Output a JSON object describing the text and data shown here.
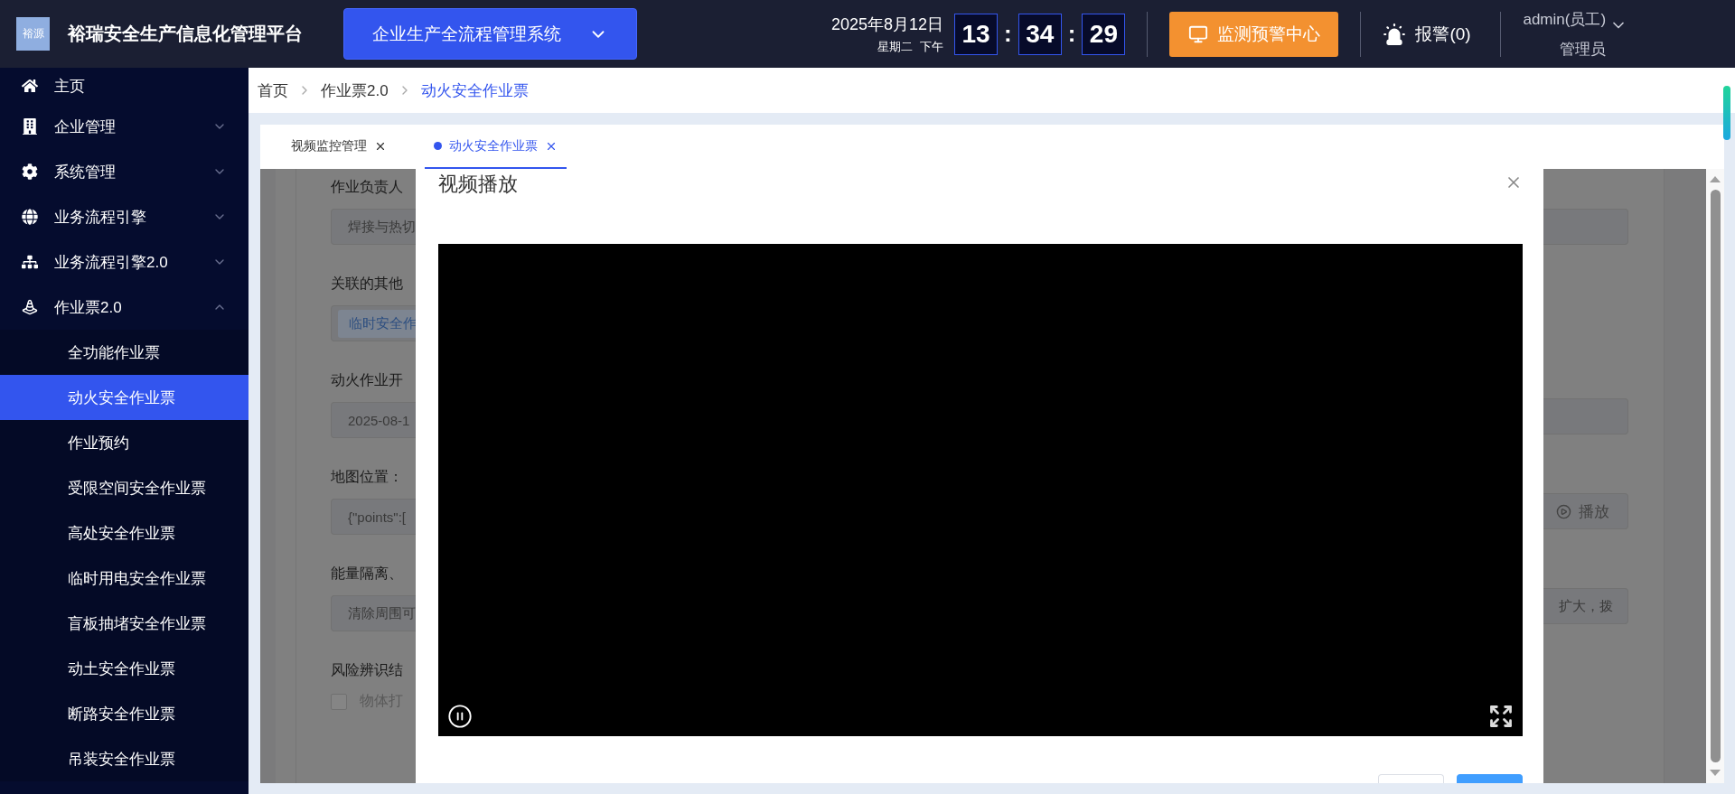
{
  "header": {
    "logo": "裕源",
    "title": "裕瑞安全生产信息化管理平台",
    "system_selector": "企业生产全流程管理系统",
    "date": "2025年8月12日",
    "weekday": "星期二",
    "period": "下午",
    "clock": [
      {
        "kind": "digits",
        "text": "13"
      },
      {
        "kind": "separator",
        "text": ":"
      },
      {
        "kind": "digits",
        "text": "34"
      },
      {
        "kind": "separator",
        "text": ":"
      },
      {
        "kind": "digits",
        "text": "29"
      }
    ],
    "monitor_button": "监测预警中心",
    "alarm": "报警(0)",
    "user": "admin(员工)",
    "role": "管理员"
  },
  "sidebar": {
    "items": [
      {
        "kind": "link",
        "label": "主页"
      },
      {
        "kind": "group",
        "label": "企业管理",
        "expanded": false
      },
      {
        "kind": "group",
        "label": "系统管理",
        "expanded": false
      },
      {
        "kind": "group",
        "label": "业务流程引擎",
        "expanded": false
      },
      {
        "kind": "group",
        "label": "业务流程引擎2.0",
        "expanded": false
      },
      {
        "kind": "group",
        "label": "作业票2.0",
        "expanded": true,
        "children": [
          {
            "label": "全功能作业票",
            "selected": false
          },
          {
            "label": "动火安全作业票",
            "selected": true
          },
          {
            "label": "作业预约",
            "selected": false
          },
          {
            "label": "受限空间安全作业票",
            "selected": false
          },
          {
            "label": "高处安全作业票",
            "selected": false
          },
          {
            "label": "临时用电安全作业票",
            "selected": false
          },
          {
            "label": "盲板抽堵安全作业票",
            "selected": false
          },
          {
            "label": "动土安全作业票",
            "selected": false
          },
          {
            "label": "断路安全作业票",
            "selected": false
          },
          {
            "label": "吊装安全作业票",
            "selected": false
          }
        ]
      }
    ]
  },
  "breadcrumb": [
    {
      "label": "首页",
      "current": false
    },
    {
      "label": "作业票2.0",
      "current": false
    },
    {
      "label": "动火安全作业票",
      "current": true
    }
  ],
  "tabs": [
    {
      "label": "视频监控管理",
      "selected": false
    },
    {
      "label": "动火安全作业票",
      "selected": true
    }
  ],
  "background_form": {
    "left": [
      {
        "label": "作业负责人",
        "field": {
          "kind": "input",
          "value": "焊接与热切"
        }
      },
      {
        "label": "关联的其他",
        "field": {
          "kind": "tag",
          "value": "临时安全作"
        }
      },
      {
        "label": "动火作业开",
        "field": {
          "kind": "input",
          "value": "2025-08-1"
        }
      },
      {
        "label": "地图位置：",
        "field": {
          "kind": "input",
          "value": "{\"points\":["
        }
      },
      {
        "label": "能量隔离、",
        "field": {
          "kind": "input",
          "value": "清除周围可"
        }
      },
      {
        "label": "风险辨识结",
        "field": {
          "kind": "checkbox",
          "value": "物体打",
          "checked": false
        }
      }
    ],
    "right": [
      {
        "kind": "blank"
      },
      {
        "kind": "none"
      },
      {
        "kind": "blank"
      },
      {
        "kind": "button",
        "label": "播放"
      },
      {
        "kind": "input",
        "value": "扩大，拨"
      }
    ]
  },
  "dialog": {
    "title": "视频播放",
    "video": {
      "playing": true
    },
    "buttons": [
      {
        "kind": "default"
      },
      {
        "kind": "primary"
      }
    ]
  }
}
